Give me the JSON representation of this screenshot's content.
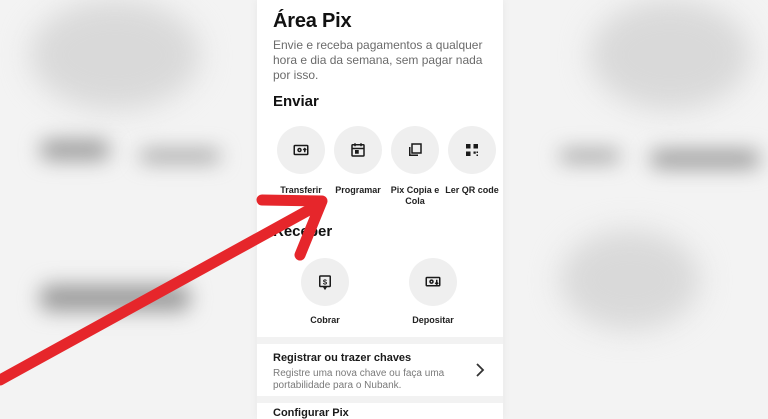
{
  "pix": {
    "title": "Área Pix",
    "description": "Envie e receba pagamentos a qualquer hora e dia da semana, sem pagar nada por isso."
  },
  "send": {
    "heading": "Enviar",
    "actions": [
      {
        "label": "Transferir",
        "icon": "transfer-icon"
      },
      {
        "label": "Programar",
        "icon": "calendar-icon"
      },
      {
        "label": "Pix Copia e Cola",
        "icon": "copy-icon"
      },
      {
        "label": "Ler QR code",
        "icon": "qr-code-icon"
      }
    ]
  },
  "receive": {
    "heading": "Receber",
    "actions": [
      {
        "label": "Cobrar",
        "icon": "charge-icon"
      },
      {
        "label": "Depositar",
        "icon": "deposit-icon"
      }
    ]
  },
  "keys": {
    "title": "Registrar ou trazer chaves",
    "description": "Registre uma nova chave ou faça uma portabilidade para o Nubank."
  },
  "configure": {
    "title": "Configurar Pix"
  },
  "colors": {
    "arrow": "#e6262b",
    "icon": "#1a1a1a",
    "circle": "#efefef"
  }
}
